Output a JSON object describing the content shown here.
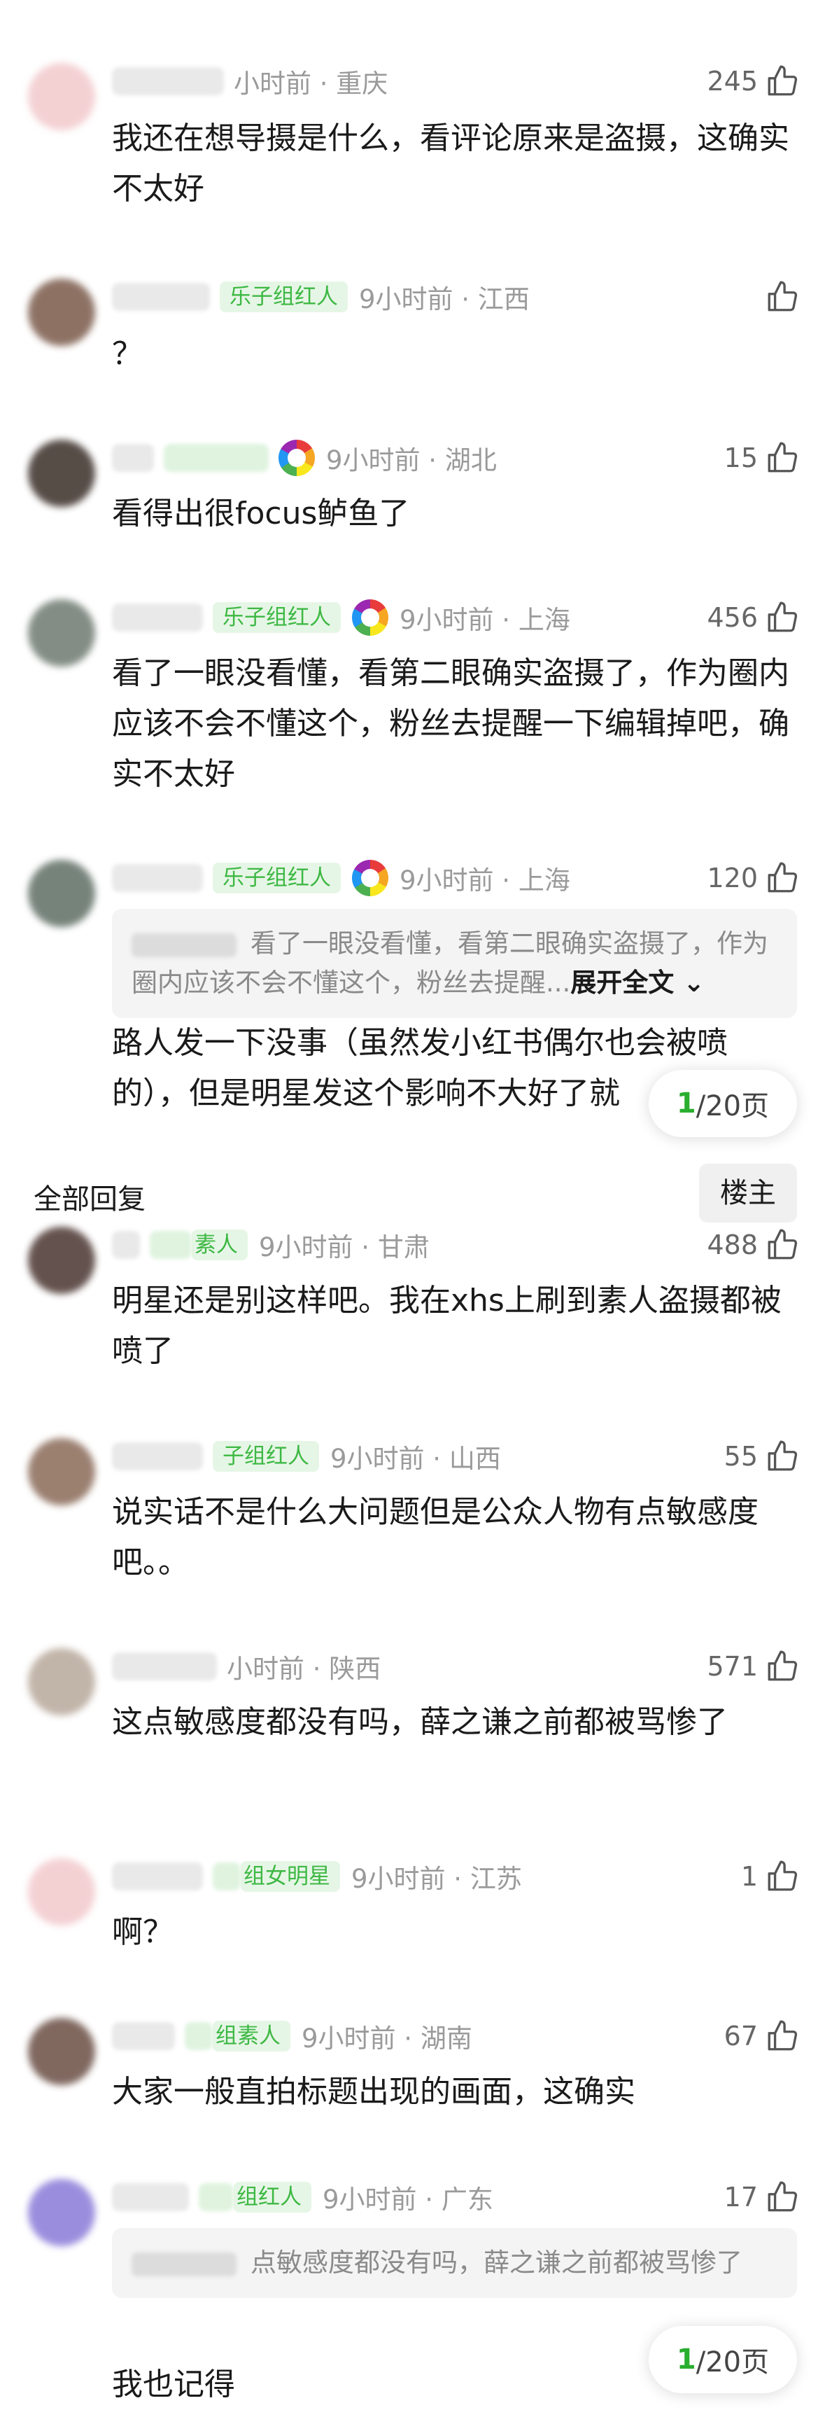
{
  "comments_top": [
    {
      "time": "小时前 · 重庆",
      "likes": "245",
      "text": "我还在想导摄是什么，看评论原来是盗摄，这确实不太好",
      "badge": "",
      "medal": false
    },
    {
      "time": "9小时前 · 江西",
      "likes": "",
      "text": "？",
      "badge": "乐子组红人",
      "medal": false
    },
    {
      "time": "9小时前 · 湖北",
      "likes": "15",
      "text": "看得出很focus鲈鱼了",
      "badge": "",
      "medal": true
    },
    {
      "time": "9小时前 · 上海",
      "likes": "456",
      "text": "看了一眼没看懂，看第二眼确实盗摄了，作为圈内应该不会不懂这个，粉丝去提醒一下编辑掉吧，确实不太好",
      "badge": "乐子组红人",
      "medal": true
    },
    {
      "time": "9小时前 · 上海",
      "likes": "120",
      "badge": "乐子组红人",
      "medal": true,
      "quote": "看了一眼没看懂，看第二眼确实盗摄了，作为圈内应该不会不懂这个，粉丝去提醒...",
      "expand": "展开全文",
      "text": "路人发一下没事（虽然发小红书偶尔也会被喷的），但是明星发这个影响不大好了就"
    }
  ],
  "pager_top": {
    "current": "1",
    "total": "/20页"
  },
  "section": {
    "title": "全部回复",
    "owner_tag": "楼主"
  },
  "replies": [
    {
      "time": "9小时前 · 甘肃",
      "likes": "488",
      "text": "明星还是别这样吧。我在xhs上刷到素人盗摄都被喷了",
      "badge": "素人"
    },
    {
      "time": "9小时前 · 山西",
      "likes": "55",
      "text": "说实话不是什么大问题但是公众人物有点敏感度吧。。",
      "badge": "子组红人"
    },
    {
      "time": "小时前 · 陕西",
      "likes": "571",
      "text": "这点敏感度都没有吗，薛之谦之前都被骂惨了",
      "badge": ""
    },
    {
      "time": "9小时前 · 江苏",
      "likes": "1",
      "text": "啊？",
      "badge": "组女明星"
    },
    {
      "time": "9小时前 · 湖南",
      "likes": "67",
      "text": "大家一般直拍标题出现的画面，这确实",
      "badge": "组素人"
    },
    {
      "time": "9小时前 · 广东",
      "likes": "17",
      "quote": "点敏感度都没有吗，薛之谦之前都被骂惨了",
      "text": "我也记得",
      "badge": "组红人"
    }
  ],
  "pager_bottom": {
    "current": "1",
    "total": "/20页"
  },
  "colors": {
    "badge_bg": "#e6f6e6",
    "badge_fg": "#3db843",
    "pager_active": "#2aae2f"
  },
  "icons": {
    "like": "thumbs-up-outline-icon",
    "expand": "chevron-down-icon"
  }
}
